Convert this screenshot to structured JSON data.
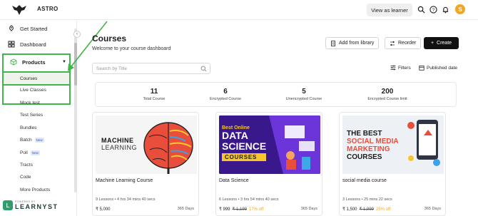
{
  "topbar": {
    "brand": "ASTRO",
    "view_as_learner": "View as learner",
    "avatar_letter": "S"
  },
  "sidebar": {
    "items": [
      {
        "label": "Get Started",
        "icon": "rocket-icon"
      },
      {
        "label": "Dashboard",
        "icon": "dashboard-icon"
      },
      {
        "label": "Products",
        "icon": "box-icon"
      }
    ],
    "sub_items": [
      {
        "label": "Courses",
        "badge": ""
      },
      {
        "label": "Live Classes",
        "badge": ""
      },
      {
        "label": "Mock test",
        "badge": ""
      },
      {
        "label": "Test Series",
        "badge": ""
      },
      {
        "label": "Bundles",
        "badge": ""
      },
      {
        "label": "Batch",
        "badge": "New"
      },
      {
        "label": "Poll",
        "badge": "New"
      },
      {
        "label": "Tracts",
        "badge": ""
      },
      {
        "label": "Code",
        "badge": ""
      },
      {
        "label": "More Products",
        "badge": ""
      }
    ],
    "footer": {
      "powered": "POWERED BY",
      "name": "LEARNYST"
    }
  },
  "main": {
    "title": "Courses",
    "subtitle": "Welcome to your course dashboard",
    "buttons": {
      "add_from_library": "Add from library",
      "reorder": "Reorder",
      "create": "Create"
    },
    "search_placeholder": "Search by Title",
    "filters": "Filters",
    "sort": "Published date",
    "stats": [
      {
        "value": "11",
        "label": "Total Course"
      },
      {
        "value": "6",
        "label": "Encrypted Course"
      },
      {
        "value": "5",
        "label": "Unencrypted Course"
      },
      {
        "value": "200",
        "label": "Encrypted Course limit"
      }
    ],
    "cards": [
      {
        "title": "Machine Learning Course",
        "thumb_text": [
          "MACHINE",
          "LEARNING"
        ],
        "meta": "9 Lessons • 4 hrs 34 mins 40 secs",
        "price": "₹ 5,000",
        "old_price": "",
        "discount": "",
        "validity": "365 Days"
      },
      {
        "title": "Data Science",
        "thumb_text": [
          "Best Online",
          "DATA",
          "SCIENCE",
          "COURSES"
        ],
        "meta": "6 Lessons • 3 hrs 54 mins 40 secs",
        "price": "₹ 999",
        "old_price": "₹ 1,199",
        "discount": "17% off",
        "validity": "365 Days"
      },
      {
        "title": "social media course",
        "thumb_text": [
          "THE BEST",
          "SOCIAL MEDIA",
          "MARKETING",
          "COURSES"
        ],
        "meta": "3 Lessons • 25 mins 22 secs",
        "price": "₹ 1,500",
        "old_price": "₹ 1,999",
        "discount": "25% off",
        "validity": "365 Days"
      }
    ]
  },
  "colors": {
    "highlight": "#3fb54a",
    "create_bg": "#111111",
    "avatar": "#f3a623",
    "discount": "#f5a623"
  }
}
